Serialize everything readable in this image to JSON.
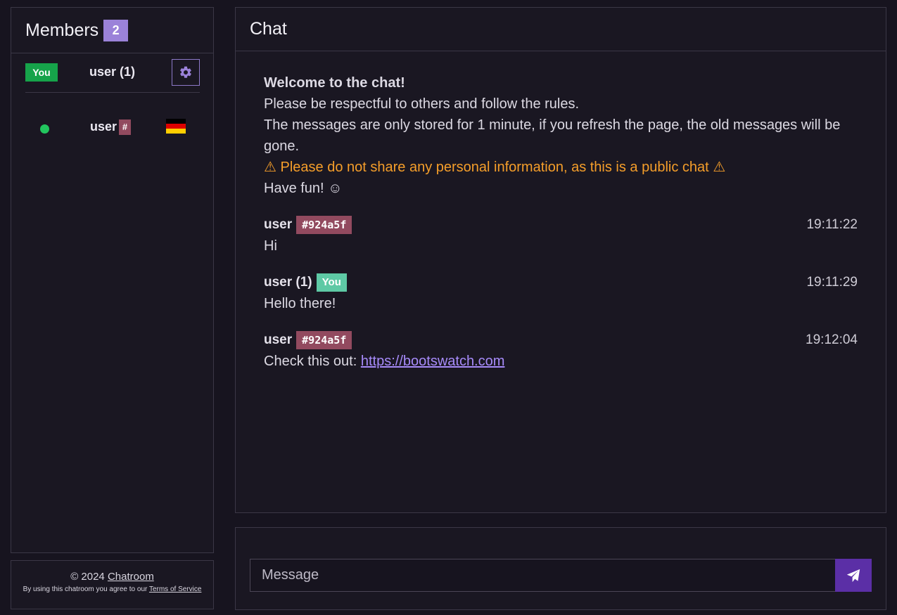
{
  "members": {
    "title": "Members",
    "count": "2",
    "self": {
      "badge": "You",
      "name": "user (1)",
      "settings_icon": "gear-icon"
    },
    "other": {
      "status": "online",
      "name": "user",
      "tag": "#",
      "flag": "germany-flag",
      "flag_colors": [
        "#000000",
        "#dd0000",
        "#ffce00"
      ]
    }
  },
  "footer": {
    "copyright_prefix": "© 2024",
    "brand_link": "Chatroom",
    "terms_prefix": "By using this chatroom you agree to our",
    "terms_link": "Terms of Service"
  },
  "chat": {
    "title": "Chat",
    "welcome": {
      "title": "Welcome to the chat!",
      "line1": "Please be respectful to others and follow the rules.",
      "line2": "The messages are only stored for 1 minute, if you refresh the page, the old messages will be gone.",
      "warning": "⚠ Please do not share any personal information, as this is a public chat ⚠",
      "fun": "Have fun! ☺"
    },
    "messages": [
      {
        "user": "user",
        "tag": "#924a5f",
        "time": "19:11:22",
        "text": "Hi"
      },
      {
        "user": "user (1)",
        "you": "You",
        "time": "19:11:29",
        "text": "Hello there!"
      },
      {
        "user": "user",
        "tag": "#924a5f",
        "time": "19:12:04",
        "text_prefix": "Check this out:",
        "link": "https://bootswatch.com"
      }
    ]
  },
  "input": {
    "placeholder": "Message",
    "send_icon": "paper-plane-icon"
  },
  "colors": {
    "accent": "#9b82d9",
    "you_badge": "#16a34a",
    "tag": "#924a5f",
    "warning": "#f59e2a",
    "send": "#5b2fa6"
  }
}
